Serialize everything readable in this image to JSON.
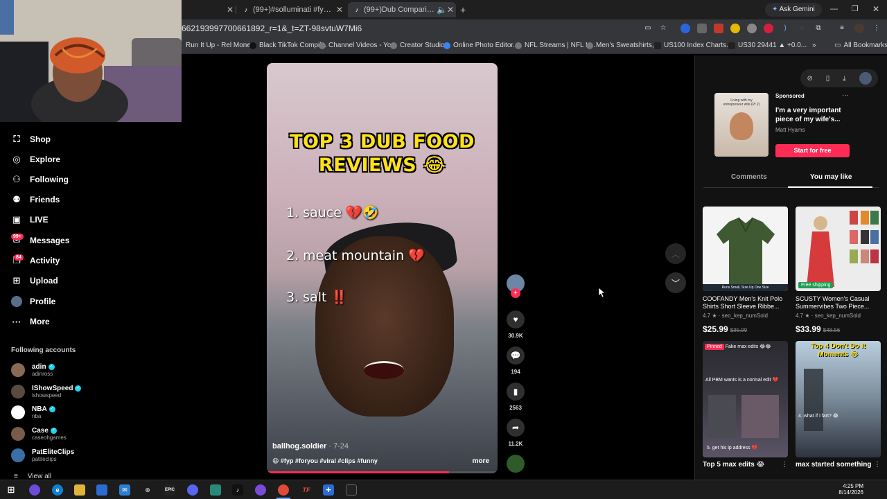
{
  "browser": {
    "tabs": [
      {
        "title": "",
        "active": false
      },
      {
        "title": "(99+)#solluminati #fyp | sollum",
        "active": false
      },
      {
        "title": "(99+)Dub Comparing Food",
        "active": true
      }
    ],
    "new_tab": "+",
    "ask_gemini": "Ask Gemini",
    "url": "662193997700661892_r=1&_t=ZT-98svtuW7Mi6",
    "bookmarks": [
      "Run It Up - Rel Money",
      "Black TikTok Compil...",
      "Channel Videos - Yo...",
      "Creator Studio",
      "Online Photo Editor...",
      "NFL Streams | NFL L...",
      "Men's Sweatshirts,...",
      "US100 Index Charts...",
      "US30 29441 ▲ +0.0..."
    ],
    "all_bookmarks": "All Bookmarks"
  },
  "sidebar": {
    "nav": [
      {
        "label": "Shop",
        "icon": "shopping-bag-icon",
        "glyph": "🛍"
      },
      {
        "label": "Explore",
        "icon": "compass-icon",
        "glyph": "⊘"
      },
      {
        "label": "Following",
        "icon": "following-icon",
        "glyph": "👤"
      },
      {
        "label": "Friends",
        "icon": "friends-icon",
        "glyph": "👥"
      },
      {
        "label": "LIVE",
        "icon": "live-icon",
        "glyph": "▣"
      },
      {
        "label": "Messages",
        "icon": "messages-icon",
        "glyph": "✉",
        "badge": "99+"
      },
      {
        "label": "Activity",
        "icon": "activity-icon",
        "glyph": "✎",
        "badge": "84"
      },
      {
        "label": "Upload",
        "icon": "upload-icon",
        "glyph": "⊞"
      },
      {
        "label": "Profile",
        "icon": "profile-icon",
        "glyph": "●"
      },
      {
        "label": "More",
        "icon": "more-icon",
        "glyph": "···"
      }
    ],
    "following_title": "Following accounts",
    "accounts": [
      {
        "name": "adin",
        "handle": "adinross",
        "color": "#8a6a55"
      },
      {
        "name": "IShowSpeed",
        "handle": "ishowspeed",
        "color": "#5b4a3e"
      },
      {
        "name": "NBA",
        "handle": "nba",
        "color": "#ffffff"
      },
      {
        "name": "Case",
        "handle": "caseohgames",
        "color": "#7a5a48"
      },
      {
        "name": "PatEliteClips",
        "handle": "patiteclips",
        "color": "#3a6ea5"
      }
    ],
    "view_all": "View all"
  },
  "video": {
    "title_line1": "TOP 3 DUB FOOD",
    "title_line2": "REVIEWS 😂",
    "items": [
      "1. sauce 💔🤣",
      "2. meat mountain 💔",
      "3. salt ‼️"
    ],
    "author": "ballhog.soldier",
    "date": " · 7-24",
    "caption": "😆 #fyp #foryou #viral #clips #funny",
    "more": "more",
    "progress": 0.79
  },
  "actions": {
    "likes": "30.9K",
    "comments": "194",
    "saves": "2563",
    "shares": "11.2K"
  },
  "right_panel": {
    "sponsored_label": "Sponsored",
    "ad_title": "I'm a very important piece of my wife's...",
    "ad_author": "Matt Hyams",
    "ad_thumb_text": "Living with my entrepreneur wife (Pt 2)",
    "ad_cta": "Start for free",
    "tab_comments": "Comments",
    "tab_you_may_like": "You may like",
    "products": [
      {
        "title": "COOFANDY Men's Knit Polo Shirts Short Sleeve Ribbe...",
        "rating": "4.7 ★ · seo_kep_numSold",
        "price": "$25.99",
        "old_price": "$35.99",
        "badge": "Runs Small, Size Up One Size"
      },
      {
        "title": "SCUSTY Women's Casual Summervibes Two Piece...",
        "rating": "4.7 ★ · seo_kep_numSold",
        "price": "$33.99",
        "old_price": "$48.56",
        "badge": "Free shipping"
      }
    ],
    "videos": [
      {
        "pinned": "Pinned",
        "top_text": "Fake max edits 😂😂",
        "mid_text": "All PBM wants is a normal edit 💔",
        "bottom_text": "5. get his ip address 💔",
        "title": "Top 5 max edits 😂"
      },
      {
        "top_text": "Top 4 Don't Do It Moments 😂",
        "mid_text": "4. what if I fart? 😂",
        "title": "max started something"
      }
    ]
  },
  "clock": {
    "time": "4:25 PM",
    "date": "8/14/2026"
  }
}
